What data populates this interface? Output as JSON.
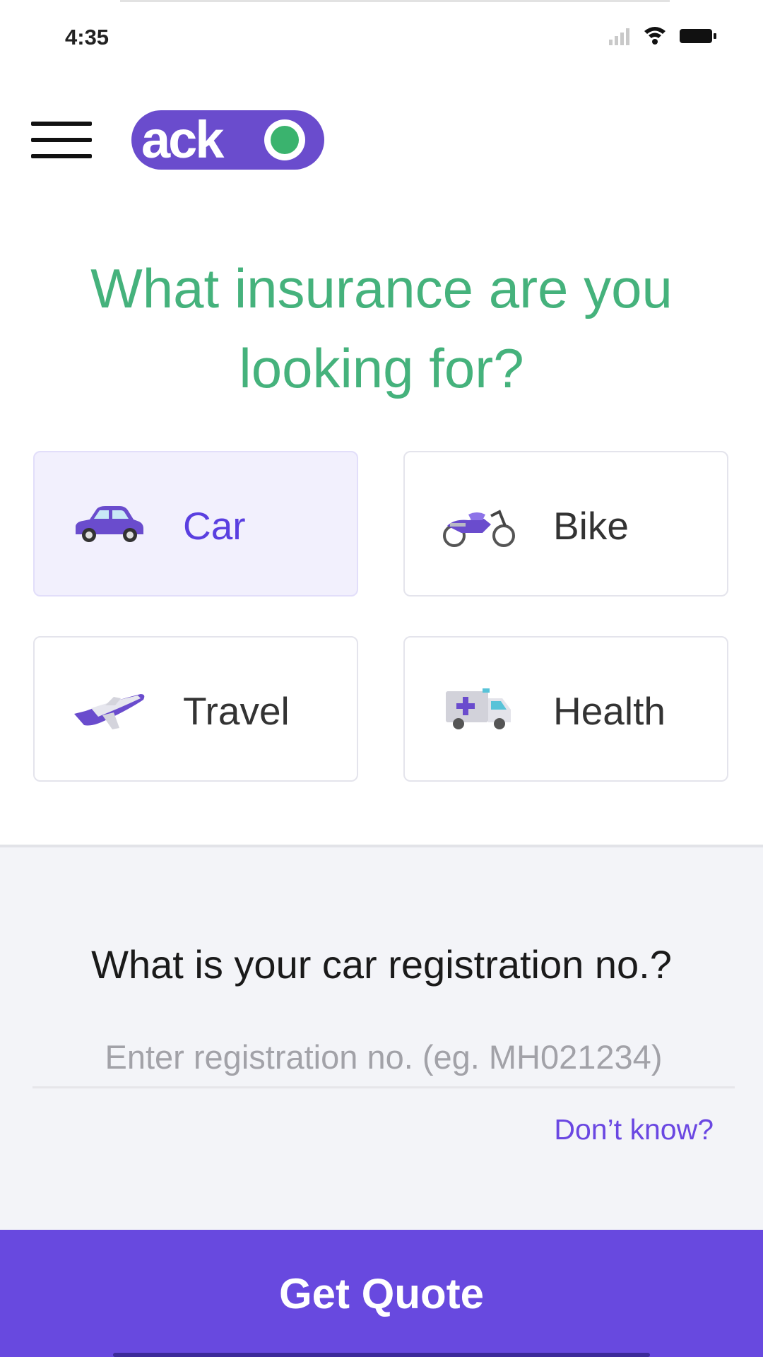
{
  "status_bar": {
    "time": "4:35",
    "icons": [
      "signal-icon",
      "wifi-icon",
      "battery-icon"
    ]
  },
  "header": {
    "menu_icon": "hamburger-menu-icon",
    "logo": {
      "text": "acko",
      "color": "#6a4ccd",
      "dot_color": "#3ab36e"
    }
  },
  "headline": {
    "line1": "What insurance are you",
    "line2": "looking for?",
    "color": "#45b27c"
  },
  "options": [
    {
      "label": "Car",
      "icon": "car-icon",
      "selected": true
    },
    {
      "label": "Bike",
      "icon": "bike-icon",
      "selected": false
    },
    {
      "label": "Travel",
      "icon": "airplane-icon",
      "selected": false
    },
    {
      "label": "Health",
      "icon": "ambulance-icon",
      "selected": false
    }
  ],
  "registration": {
    "question": "What is your car registration no.?",
    "placeholder": "Enter registration no. (eg. MH021234)",
    "value": "",
    "dont_know": "Don’t know?"
  },
  "cta": {
    "label": "Get Quote",
    "color": "#6849df"
  },
  "colors": {
    "accent": "#6849df",
    "selected_bg": "#f2f0fd",
    "headline": "#45b27c"
  }
}
